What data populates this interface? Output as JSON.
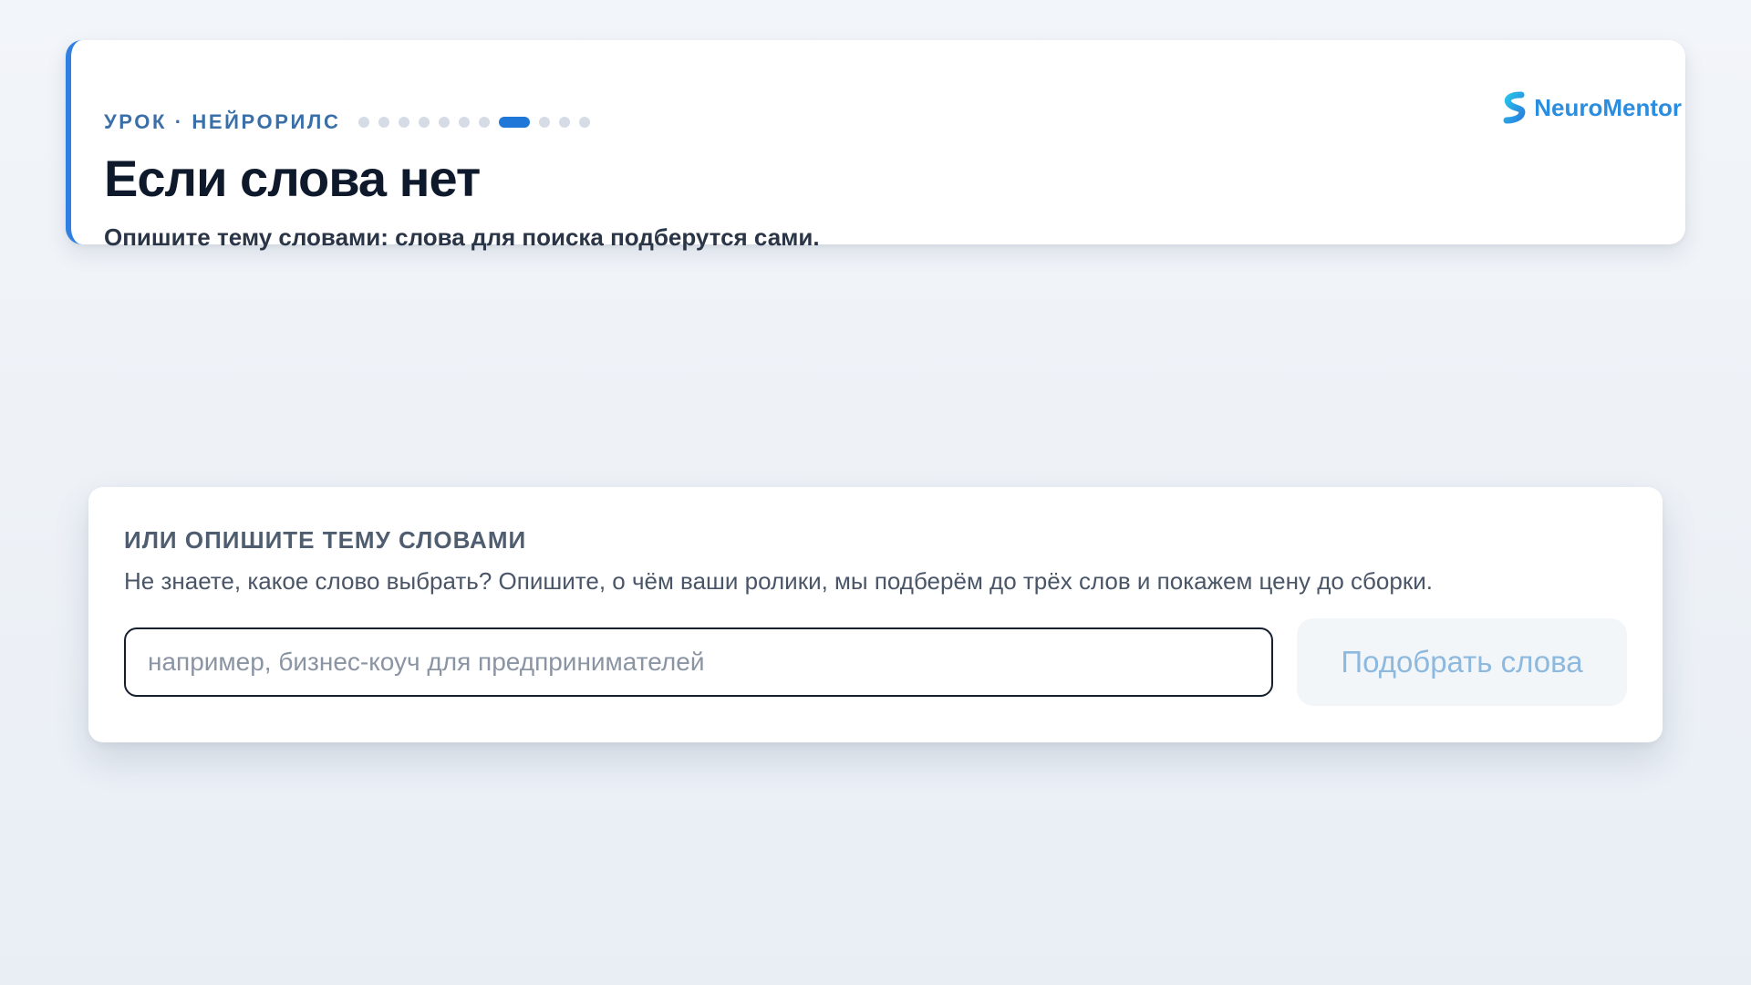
{
  "header": {
    "lesson_label": "УРОК · НЕЙРОРИЛС",
    "progress": {
      "total_steps": 11,
      "current_step": 8
    },
    "title": "Если слова нет",
    "subtitle": "Опишите тему словами: слова для поиска подберутся сами.",
    "brand": {
      "name": "NeuroMentor",
      "logo_icon": "neuromentor-logo-icon",
      "color": "#2b8de0"
    },
    "accent_color": "#2f80e0"
  },
  "describe": {
    "heading": "ИЛИ ОПИШИТЕ ТЕМУ СЛОВАМИ",
    "description": "Не знаете, какое слово выбрать? Опишите, о чём ваши ролики, мы подберём до трёх слов и покажем цену до сборки.",
    "input": {
      "value": "",
      "placeholder": "например, бизнес-коуч для предпринимателей"
    },
    "button_label": "Подобрать слова",
    "button_state": "disabled"
  }
}
